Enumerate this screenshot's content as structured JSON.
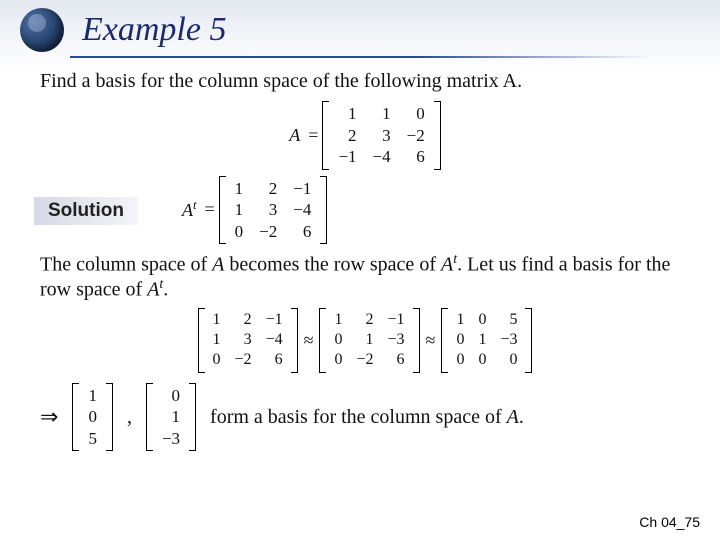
{
  "header": {
    "title": "Example 5"
  },
  "prompt": "Find a basis for the column space of the following matrix A.",
  "matrixA": {
    "label": "A",
    "rows": [
      [
        "1",
        "1",
        "0"
      ],
      [
        "2",
        "3",
        "−2"
      ],
      [
        "−1",
        "−4",
        "6"
      ]
    ]
  },
  "solution_label": "Solution",
  "matrixAt": {
    "label": "Aᵗ",
    "plain_label": "A",
    "sup": "t",
    "rows": [
      [
        "1",
        "2",
        "−1"
      ],
      [
        "1",
        "3",
        "−4"
      ],
      [
        "0",
        "−2",
        "6"
      ]
    ]
  },
  "explain_1a": "The column space of ",
  "explain_1b": " becomes the row space of ",
  "explain_1c": ". Let us find a basis for the row space of ",
  "explain_1d": ".",
  "A_ital": "A",
  "At_html": "A",
  "row_reduce": {
    "approx": "≈",
    "m1": [
      [
        "1",
        "2",
        "−1"
      ],
      [
        "1",
        "3",
        "−4"
      ],
      [
        "0",
        "−2",
        "6"
      ]
    ],
    "m2": [
      [
        "1",
        "2",
        "−1"
      ],
      [
        "0",
        "1",
        "−3"
      ],
      [
        "0",
        "−2",
        "6"
      ]
    ],
    "m3": [
      [
        "1",
        "0",
        "5"
      ],
      [
        "0",
        "1",
        "−3"
      ],
      [
        "0",
        "0",
        "0"
      ]
    ]
  },
  "therefore": "⇒",
  "basis": {
    "v1": [
      [
        "1"
      ],
      [
        "0"
      ],
      [
        "5"
      ]
    ],
    "v2": [
      [
        "0"
      ],
      [
        "1"
      ],
      [
        "−3"
      ]
    ],
    "comma": ","
  },
  "final_text_a": "form a basis for the column space of ",
  "final_text_b": ".",
  "footer": "Ch 04_75"
}
